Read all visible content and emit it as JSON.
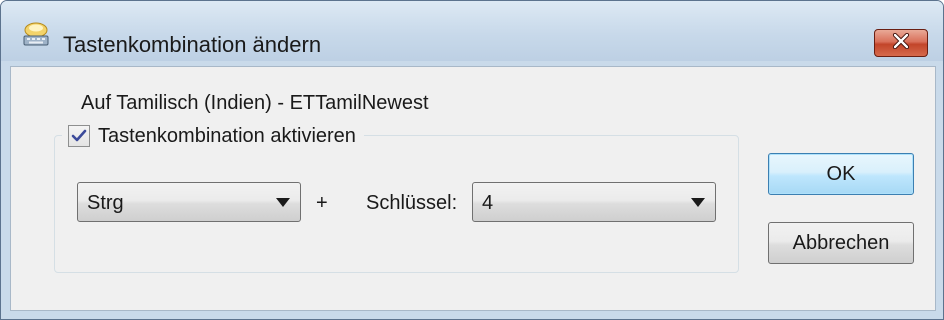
{
  "window": {
    "title": "Tastenkombination ändern",
    "title_icon": "keyboard-icon",
    "close_icon": "close-icon"
  },
  "dialog": {
    "language_label": "Auf Tamilisch (Indien) - ETTamilNewest",
    "enable_checkbox": {
      "label": "Tastenkombination aktivieren",
      "checked": true
    },
    "modifier_combo": {
      "value": "Strg"
    },
    "plus_label": "+",
    "key_label": "Schlüssel:",
    "key_combo": {
      "value": "4"
    },
    "ok_button": "OK",
    "cancel_button": "Abbrechen"
  },
  "colors": {
    "titlebar": "#c8d9ea",
    "close_button": "#c2452a",
    "default_button_border": "#3c7fb1"
  }
}
